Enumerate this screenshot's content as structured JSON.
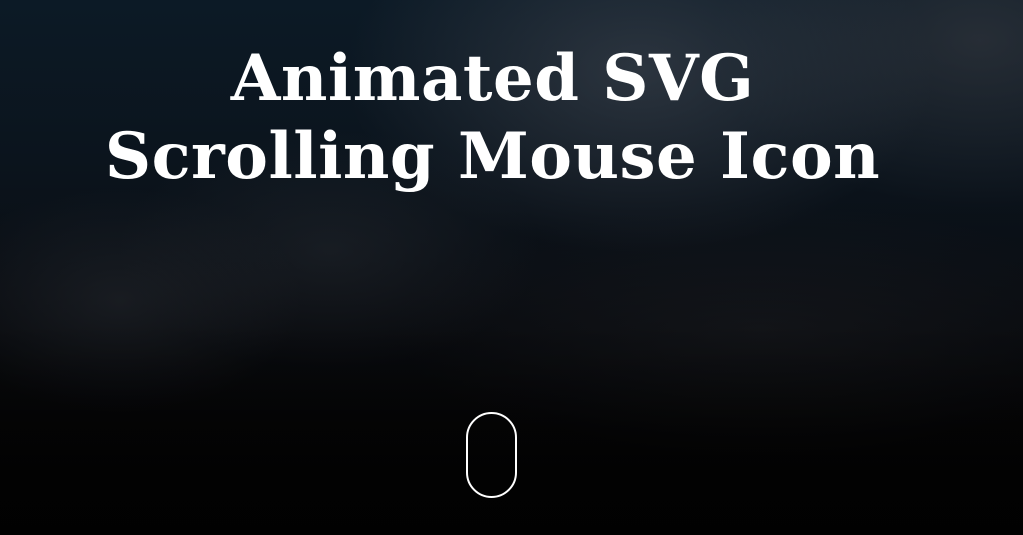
{
  "hero": {
    "title_line1": "Animated SVG",
    "title_line2": "Scrolling Mouse Icon"
  },
  "mouse_icon": {
    "icon": "mouse-icon",
    "stroke_color": "#ffffff"
  },
  "colors": {
    "text": "#ffffff",
    "background_top": "#0c1a26",
    "background_bottom": "#020202"
  }
}
